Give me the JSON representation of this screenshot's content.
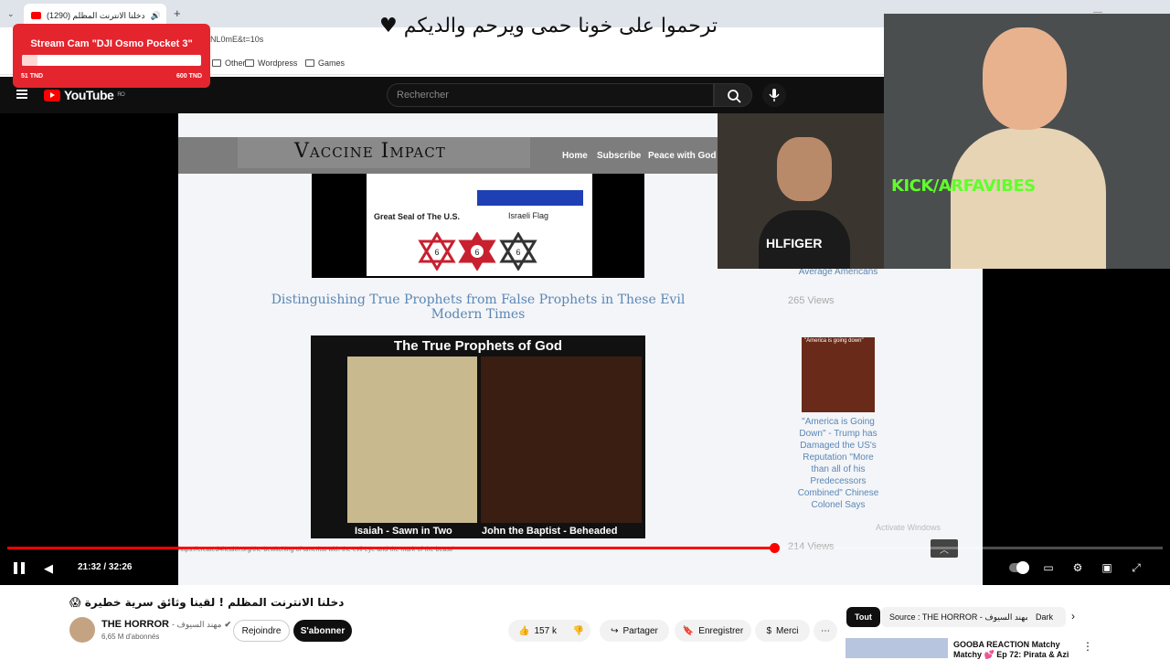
{
  "browser": {
    "tab_title": "(1290) دخلنا الانترنت المظلم",
    "url_fragment": "NL0mE&t=10s",
    "bookmarks": [
      "Other",
      "Wordpress",
      "Games"
    ]
  },
  "donation": {
    "title": "Stream Cam \"DJI Osmo Pocket 3\"",
    "min": "51 TND",
    "max": "600 TND",
    "progress_fraction": 0.085
  },
  "overlay_banner": "ترحموا على خونا حمى ويرحم والديكم ♥",
  "youtube": {
    "logo": "YouTube",
    "logo_region": "RO",
    "search_placeholder": "Rechercher"
  },
  "webpage": {
    "site_title": "Vaccine Impact",
    "nav": [
      "Home",
      "Subscribe",
      "Peace with God"
    ],
    "seal_caption": "Great Seal of The U.S.",
    "flag_caption": "Israeli Flag",
    "star_numbers": [
      "6",
      "6",
      "6"
    ],
    "article_title": "Distinguishing True Prophets from False Prophets in These Evil Modern Times",
    "image_title": "The True Prophets of God",
    "caption_left": "Isaiah - Sawn in Two",
    "caption_right": "John the Baptist - Beheaded",
    "sidebar_fragment": "Average Americans",
    "sidebar_views": "265 Views",
    "sidebar_image_caption": "\"America is going down\"",
    "sidebar_article": "\"America is Going Down\" - Trump has Damaged the US's Reputation \"More than all of his Predecessors Combined\" Chinese Colonel Says",
    "hover_url": "https://created4health.org/the-bewitching-of-america-with-the-evil-eye-and-the-mark-of-the-beast/",
    "activate_windows": "Activate Windows",
    "views_bottom": "214 Views"
  },
  "webcam": {
    "kick_text": "KICK/ARFAVIBES",
    "shirt_text": "HLFIGER"
  },
  "player": {
    "time_current": "21:32",
    "time_total": "32:26",
    "time_display": "21:32 / 32:26",
    "progress_fraction": 0.6635
  },
  "video": {
    "title": "دخلنا الانترنت المظلم ! لقينا وثائق سرية خطيرة 😱",
    "channel_name": "THE HORROR",
    "channel_suffix": "- مهند السيوف",
    "subscribers": "6,65 M d'abonnés",
    "join_label": "Rejoindre",
    "subscribe_label": "S'abonner",
    "likes": "157 k",
    "share_label": "Partager",
    "save_label": "Enregistrer",
    "thanks_label": "Merci"
  },
  "recommendations": {
    "chips": [
      "Tout",
      "Source : THE HORROR - مهند السيوف",
      "Dark"
    ],
    "first_title": "GOOBA REACTION Matchy Matchy 💕 Ep 72: Pirata & Azi"
  }
}
